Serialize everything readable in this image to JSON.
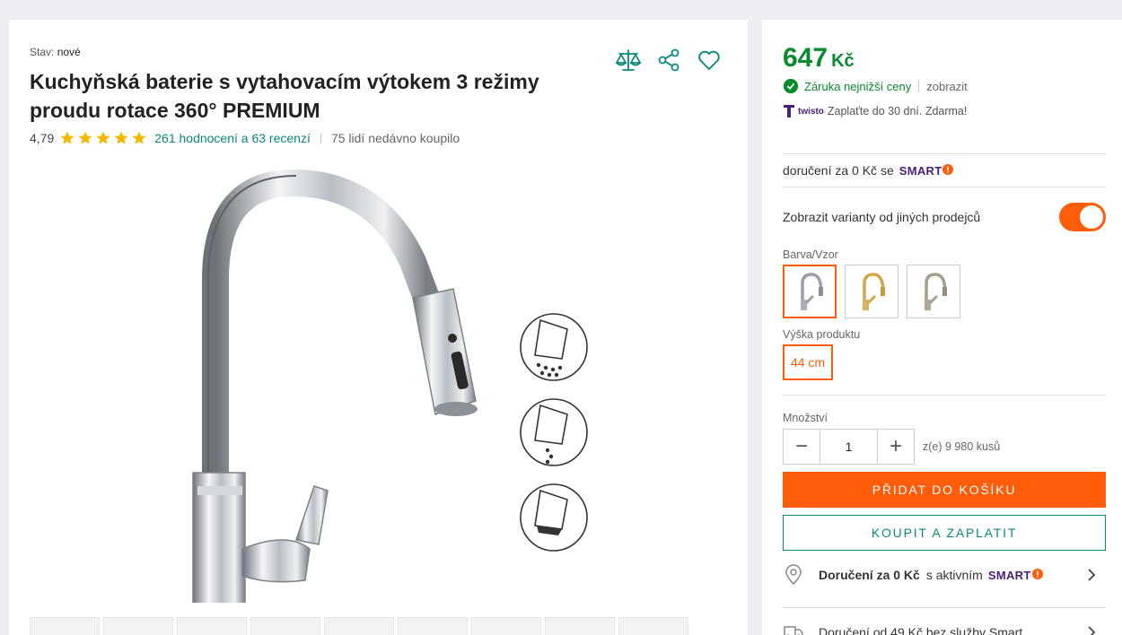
{
  "product": {
    "condition_label": "Stav:",
    "condition_value": "nové",
    "title": "Kuchyňská baterie s vytahovacím výtokem 3 režimy proudu rotace 360° PREMIUM",
    "rating": "4,79",
    "stars": 5,
    "reviews_link": "261 hodnocení a 63 recenzí",
    "bought_recently": "75 lidí nedávno koupilo"
  },
  "actions": {
    "compare_icon": "scales-icon",
    "share_icon": "share-icon",
    "wishlist_icon": "heart-icon"
  },
  "gallery": {
    "thumbnail_count": 10
  },
  "price": {
    "amount": "647",
    "currency": "Kč",
    "guarantee": "Záruka nejnižší ceny",
    "guarantee_link": "zobrazit",
    "twisto_logo": "twisto",
    "twisto_text": "Zaplaťte do 30 dní. Zdarma!"
  },
  "smart_delivery": {
    "text": "doručení za 0 Kč se",
    "logo": "SMART"
  },
  "variants": {
    "toggle_label": "Zobrazit varianty od jiných prodejců",
    "toggle_on": true,
    "color_label": "Barva/Vzor",
    "colors": [
      "chrome",
      "gold",
      "brushed"
    ],
    "height_label": "Výška produktu",
    "height_value": "44 cm"
  },
  "quantity": {
    "label": "Množství",
    "value": "1",
    "minus": "−",
    "plus": "+",
    "stock": "z(e) 9 980 kusů"
  },
  "buttons": {
    "add_to_cart": "PŘIDAT DO KOŠÍKU",
    "buy_now": "KOUPIT A ZAPLATIT"
  },
  "delivery": {
    "row1_bold": "Doručení za 0 Kč",
    "row1_text": "s aktivním",
    "row1_logo": "SMART",
    "row2_text": "Doručení od 49 Kč bez služby Smart"
  },
  "colors": {
    "accent_orange": "#ff5d0a",
    "price_green": "#0a8a2e",
    "teal": "#0a8a7a",
    "smart_purple": "#4b2177",
    "star_yellow": "#f5b800"
  }
}
